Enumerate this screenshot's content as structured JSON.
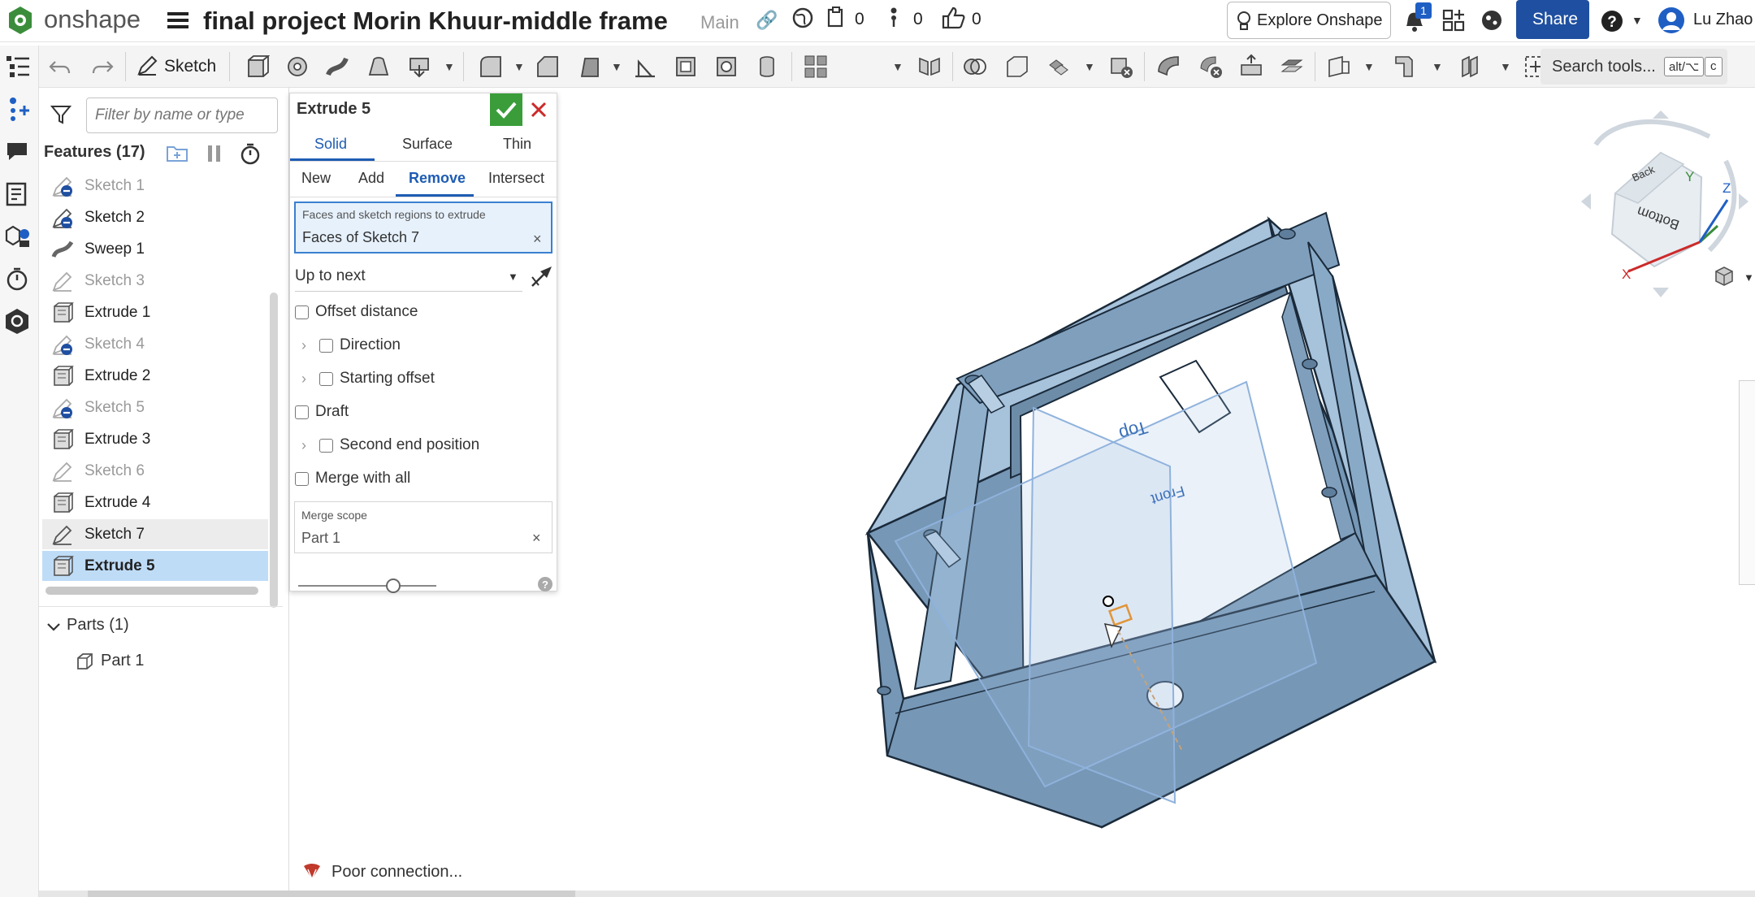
{
  "header": {
    "app_name": "onshape",
    "doc_title": "final project Morin Khuur-middle frame",
    "branch": "Main",
    "versions_count": "0",
    "branches_count": "0",
    "likes_count": "0",
    "explore_label": "Explore Onshape",
    "notifications_badge": "1",
    "share_label": "Share",
    "user_name": "Lu Zhao"
  },
  "toolbar": {
    "sketch_label": "Sketch",
    "search_label": "Search tools...",
    "search_shortcut_key": "alt/⌥",
    "search_shortcut_letter": "c"
  },
  "features_panel": {
    "filter_placeholder": "Filter by name or type",
    "header": "Features (17)",
    "items": [
      {
        "label": "Sketch 1",
        "type": "sketch",
        "state": "hidden"
      },
      {
        "label": "Sketch 2",
        "type": "sketch",
        "state": "hidden-active"
      },
      {
        "label": "Sweep 1",
        "type": "sweep",
        "state": "normal"
      },
      {
        "label": "Sketch 3",
        "type": "sketch",
        "state": "dimmed"
      },
      {
        "label": "Extrude 1",
        "type": "extrude",
        "state": "normal"
      },
      {
        "label": "Sketch 4",
        "type": "sketch",
        "state": "hidden"
      },
      {
        "label": "Extrude 2",
        "type": "extrude",
        "state": "normal"
      },
      {
        "label": "Sketch 5",
        "type": "sketch",
        "state": "hidden"
      },
      {
        "label": "Extrude 3",
        "type": "extrude",
        "state": "normal"
      },
      {
        "label": "Sketch 6",
        "type": "sketch",
        "state": "dimmed"
      },
      {
        "label": "Extrude 4",
        "type": "extrude",
        "state": "normal"
      },
      {
        "label": "Sketch 7",
        "type": "sketch",
        "state": "hover"
      },
      {
        "label": "Extrude 5",
        "type": "extrude",
        "state": "selected"
      }
    ],
    "parts_header": "Parts (1)",
    "parts": [
      "Part 1"
    ]
  },
  "dialog": {
    "title": "Extrude 5",
    "tabs": [
      "Solid",
      "Surface",
      "Thin"
    ],
    "active_tab": "Solid",
    "ops": [
      "New",
      "Add",
      "Remove",
      "Intersect"
    ],
    "active_op": "Remove",
    "faces_label": "Faces and sketch regions to extrude",
    "faces_value": "Faces of Sketch 7",
    "end_type": "Up to next",
    "offset_distance": "Offset distance",
    "direction": "Direction",
    "starting_offset": "Starting offset",
    "draft": "Draft",
    "second_end": "Second end position",
    "merge_with_all": "Merge with all",
    "merge_scope_label": "Merge scope",
    "merge_scope_value": "Part 1"
  },
  "status": {
    "connection": "Poor connection..."
  },
  "viewport": {
    "planes": [
      "Top",
      "Front"
    ],
    "view_cube": {
      "faces": [
        "Back",
        "Bottom"
      ],
      "axes": [
        "X",
        "Y",
        "Z"
      ]
    }
  },
  "colors": {
    "accent_blue": "#1e5cb3",
    "share_blue": "#1f4fa0",
    "accept_green": "#3a9d3a",
    "cancel_red": "#cc2a2a",
    "selected_row": "#bfdcf7",
    "part_body": "#7f9fbd"
  }
}
